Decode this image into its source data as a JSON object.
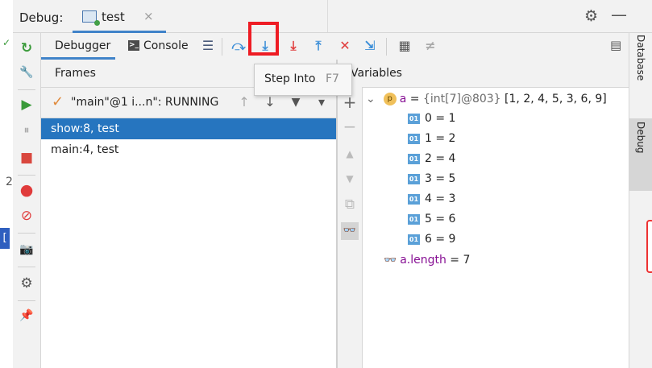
{
  "title_bar": {
    "debug_label": "Debug:",
    "tab_label": "test",
    "tab_close": "×",
    "gear_icon": "⚙",
    "minimize_icon": "—"
  },
  "left_toolbar": {
    "rerun_icon": "↻",
    "settings_wrench_icon": "🔧",
    "resume_icon": "▶",
    "pause_icon": "⏸",
    "stop_icon": "■",
    "view_breakpoints_icon": "●",
    "mute_breakpoints_icon": "⊘",
    "camera_icon": "📷",
    "settings_icon": "⚙",
    "pin_icon": "📌"
  },
  "tabs": {
    "debugger": "Debugger",
    "console": "Console",
    "console_icon_glyph": ">_"
  },
  "toolbar": {
    "menu_icon": "☰",
    "show_execution_point_icon": "⤼",
    "step_over_icon": "⤵",
    "step_into_icon": "⤓",
    "force_step_into_icon": "⤓",
    "step_out_icon": "⤒",
    "drop_frame_icon": "✕",
    "run_to_cursor_icon": "⇲",
    "evaluate_icon": "▦",
    "trace_icon": "≠"
  },
  "tooltip": {
    "label": "Step Into",
    "shortcut": "F7"
  },
  "frames": {
    "title": "Frames",
    "thread": "\"main\"@1 i...n\": RUNNING",
    "check_icon": "✓",
    "up_icon": "↑",
    "down_icon": "↓",
    "filter_icon": "▼",
    "dropdown_icon": "▾",
    "items": [
      {
        "label": "show:8, test",
        "selected": true
      },
      {
        "label": "main:4, test",
        "selected": false
      }
    ]
  },
  "variables": {
    "title": "Variables",
    "side_buttons": {
      "add_icon": "+",
      "remove_icon": "−",
      "up_icon": "▲",
      "down_icon": "▼",
      "copy_icon": "⧉",
      "watch_icon": "👓"
    },
    "root": {
      "expand_icon": "⌄",
      "badge": "p",
      "name": "a",
      "eq": " = ",
      "type": "{int[7]@803}",
      "value": " [1, 2, 4, 5, 3, 6, 9]"
    },
    "elements": [
      {
        "badge": "01",
        "text": "0 = 1"
      },
      {
        "badge": "01",
        "text": "1 = 2"
      },
      {
        "badge": "01",
        "text": "2 = 4"
      },
      {
        "badge": "01",
        "text": "3 = 5"
      },
      {
        "badge": "01",
        "text": "4 = 3"
      },
      {
        "badge": "01",
        "text": "5 = 6"
      },
      {
        "badge": "01",
        "text": "6 = 9"
      }
    ],
    "length_name": "a.length",
    "length_value": " = 7"
  },
  "right_strip": {
    "database": "Database",
    "debug": "Debug",
    "layout_icon": "▤"
  },
  "edge": {
    "fragment": "[",
    "glyph1": "✓",
    "glyph2": "2"
  },
  "colors": {
    "accent": "#4083c9",
    "selection": "#2675bf",
    "highlight": "#ee1c24",
    "step_blue": "#3b8ed8",
    "step_red": "#e03b3b"
  }
}
